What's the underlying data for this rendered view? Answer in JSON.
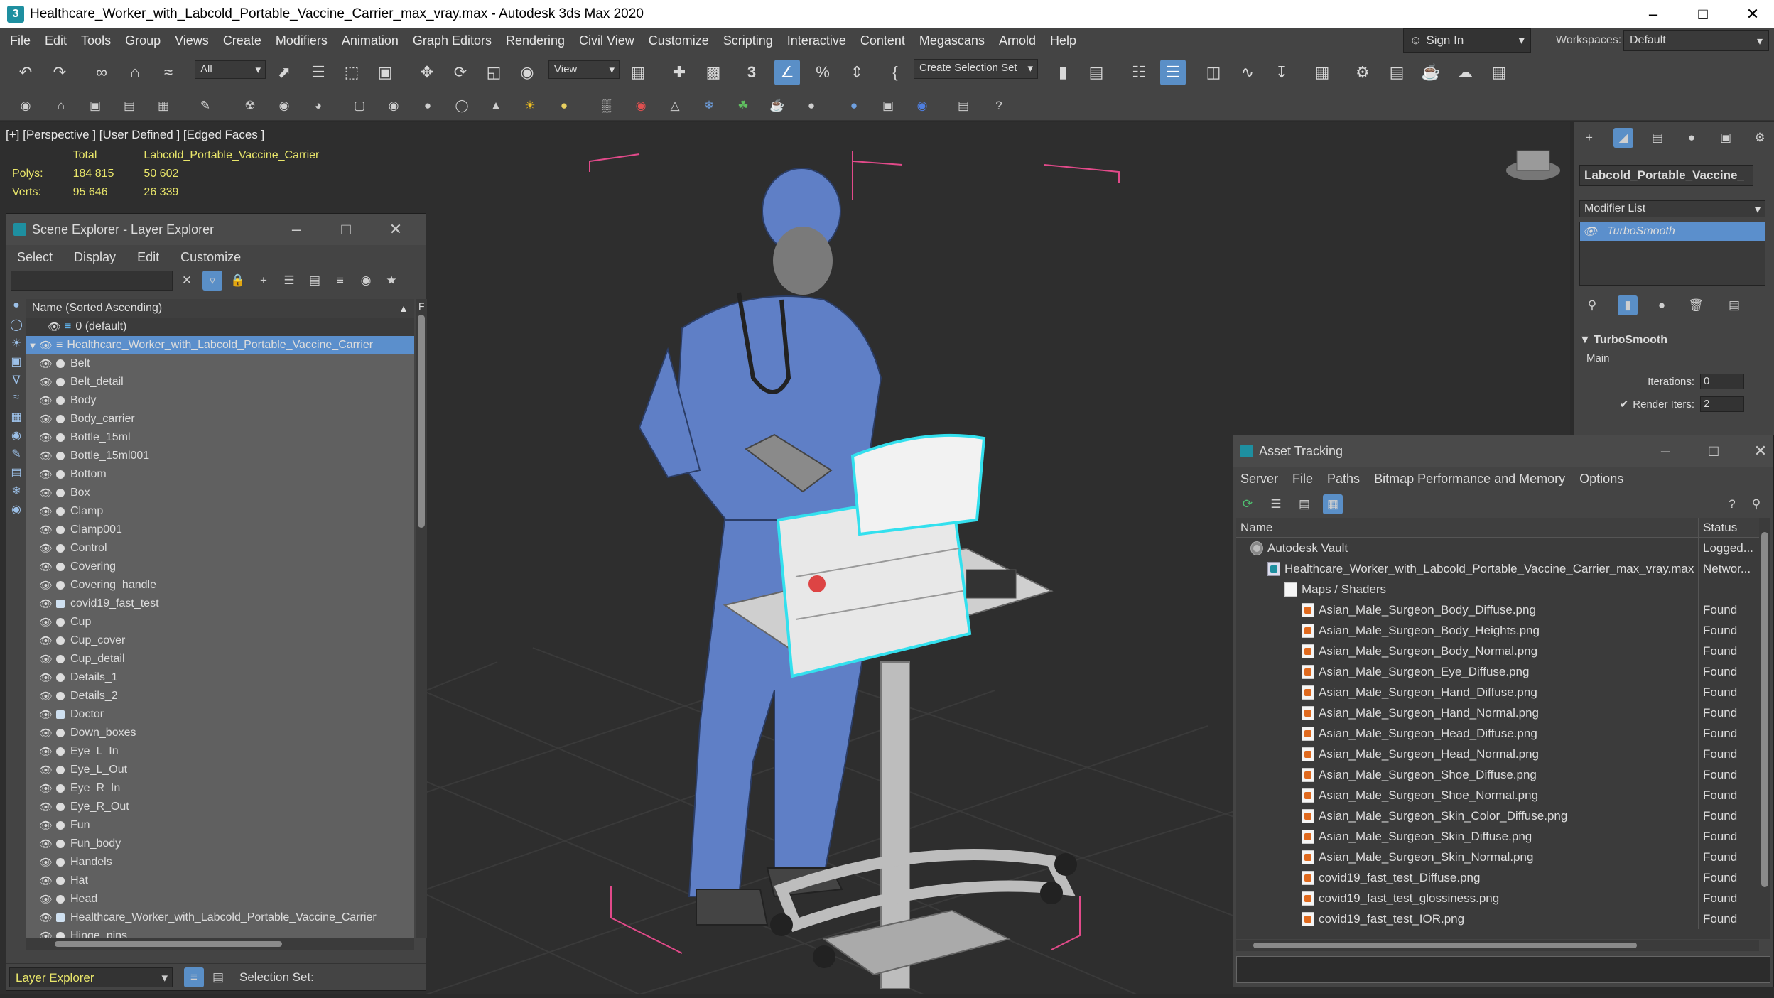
{
  "window": {
    "title": "Healthcare_Worker_with_Labcold_Portable_Vaccine_Carrier_max_vray.max - Autodesk 3ds Max 2020",
    "app_icon": "3",
    "controls": [
      "–",
      "□",
      "✕"
    ]
  },
  "menu": [
    "File",
    "Edit",
    "Tools",
    "Group",
    "Views",
    "Create",
    "Modifiers",
    "Animation",
    "Graph Editors",
    "Rendering",
    "Civil View",
    "Customize",
    "Scripting",
    "Interactive",
    "Content",
    "Megascans",
    "Arnold",
    "Help"
  ],
  "account": {
    "sign_in": "Sign In",
    "workspaces_label": "Workspaces:",
    "workspace": "Default"
  },
  "toolbar": {
    "filter_select": "All",
    "ref_coord_select": "View",
    "create_selection_set": "Create Selection Set",
    "snap_number": "3"
  },
  "viewport": {
    "label": "[+] [Perspective ] [User Defined ] [Edged Faces ]",
    "stats": {
      "header_total": "Total",
      "header_object": "Labcold_Portable_Vaccine_Carrier",
      "polys_label": "Polys:",
      "polys_total": "184 815",
      "polys_object": "50 602",
      "verts_label": "Verts:",
      "verts_total": "95 646",
      "verts_object": "26 339"
    },
    "colors": {
      "wire_body": "#5f7fc6",
      "selection": "#33e0ee",
      "bbox": "#e24a8a",
      "grid": "#3c3c3c"
    }
  },
  "scene_explorer": {
    "title": "Scene Explorer - Layer Explorer",
    "menu": [
      "Select",
      "Display",
      "Edit",
      "Customize"
    ],
    "column_header": "Name (Sorted Ascending)",
    "column_f": "F",
    "layer_default": "0 (default)",
    "layer_root": "Healthcare_Worker_with_Labcold_Portable_Vaccine_Carrier",
    "items": [
      "Belt",
      "Belt_detail",
      "Body",
      "Body_carrier",
      "Bottle_15ml",
      "Bottle_15ml001",
      "Bottom",
      "Box",
      "Clamp",
      "Clamp001",
      "Control",
      "Covering",
      "Covering_handle",
      "covid19_fast_test",
      "Cup",
      "Cup_cover",
      "Cup_detail",
      "Details_1",
      "Details_2",
      "Doctor",
      "Down_boxes",
      "Eye_L_In",
      "Eye_L_Out",
      "Eye_R_In",
      "Eye_R_Out",
      "Fun",
      "Fun_body",
      "Handels",
      "Hat",
      "Head",
      "Healthcare_Worker_with_Labcold_Portable_Vaccine_Carrier",
      "Hinge_pins"
    ],
    "footer_select": "Layer Explorer",
    "footer_selection_set": "Selection Set:"
  },
  "command_panel": {
    "object_name": "Labcold_Portable_Vaccine_",
    "modifier_list": "Modifier List",
    "stack_item": "TurboSmooth",
    "rollout_title": "TurboSmooth",
    "main_label": "Main",
    "iterations_label": "Iterations:",
    "iterations_value": "0",
    "render_iters_label": "Render Iters:",
    "render_iters_value": "2"
  },
  "asset_tracking": {
    "title": "Asset Tracking",
    "menu": [
      "Server",
      "File",
      "Paths",
      "Bitmap Performance and Memory",
      "Options"
    ],
    "col_name": "Name",
    "col_status": "Status",
    "rows": [
      {
        "name": "Autodesk Vault",
        "status": "Logged...",
        "indent": 0,
        "icon": "vault"
      },
      {
        "name": "Healthcare_Worker_with_Labcold_Portable_Vaccine_Carrier_max_vray.max",
        "status": "Networ...",
        "indent": 1,
        "icon": "max"
      },
      {
        "name": "Maps / Shaders",
        "status": "",
        "indent": 2,
        "icon": "folder"
      },
      {
        "name": "Asian_Male_Surgeon_Body_Diffuse.png",
        "status": "Found",
        "indent": 3,
        "icon": "image"
      },
      {
        "name": "Asian_Male_Surgeon_Body_Heights.png",
        "status": "Found",
        "indent": 3,
        "icon": "image"
      },
      {
        "name": "Asian_Male_Surgeon_Body_Normal.png",
        "status": "Found",
        "indent": 3,
        "icon": "image"
      },
      {
        "name": "Asian_Male_Surgeon_Eye_Diffuse.png",
        "status": "Found",
        "indent": 3,
        "icon": "image"
      },
      {
        "name": "Asian_Male_Surgeon_Hand_Diffuse.png",
        "status": "Found",
        "indent": 3,
        "icon": "image"
      },
      {
        "name": "Asian_Male_Surgeon_Hand_Normal.png",
        "status": "Found",
        "indent": 3,
        "icon": "image"
      },
      {
        "name": "Asian_Male_Surgeon_Head_Diffuse.png",
        "status": "Found",
        "indent": 3,
        "icon": "image"
      },
      {
        "name": "Asian_Male_Surgeon_Head_Normal.png",
        "status": "Found",
        "indent": 3,
        "icon": "image"
      },
      {
        "name": "Asian_Male_Surgeon_Shoe_Diffuse.png",
        "status": "Found",
        "indent": 3,
        "icon": "image"
      },
      {
        "name": "Asian_Male_Surgeon_Shoe_Normal.png",
        "status": "Found",
        "indent": 3,
        "icon": "image"
      },
      {
        "name": "Asian_Male_Surgeon_Skin_Color_Diffuse.png",
        "status": "Found",
        "indent": 3,
        "icon": "image"
      },
      {
        "name": "Asian_Male_Surgeon_Skin_Diffuse.png",
        "status": "Found",
        "indent": 3,
        "icon": "image"
      },
      {
        "name": "Asian_Male_Surgeon_Skin_Normal.png",
        "status": "Found",
        "indent": 3,
        "icon": "image"
      },
      {
        "name": "covid19_fast_test_Diffuse.png",
        "status": "Found",
        "indent": 3,
        "icon": "image"
      },
      {
        "name": "covid19_fast_test_glossiness.png",
        "status": "Found",
        "indent": 3,
        "icon": "image"
      },
      {
        "name": "covid19_fast_test_IOR.png",
        "status": "Found",
        "indent": 3,
        "icon": "image"
      }
    ]
  }
}
